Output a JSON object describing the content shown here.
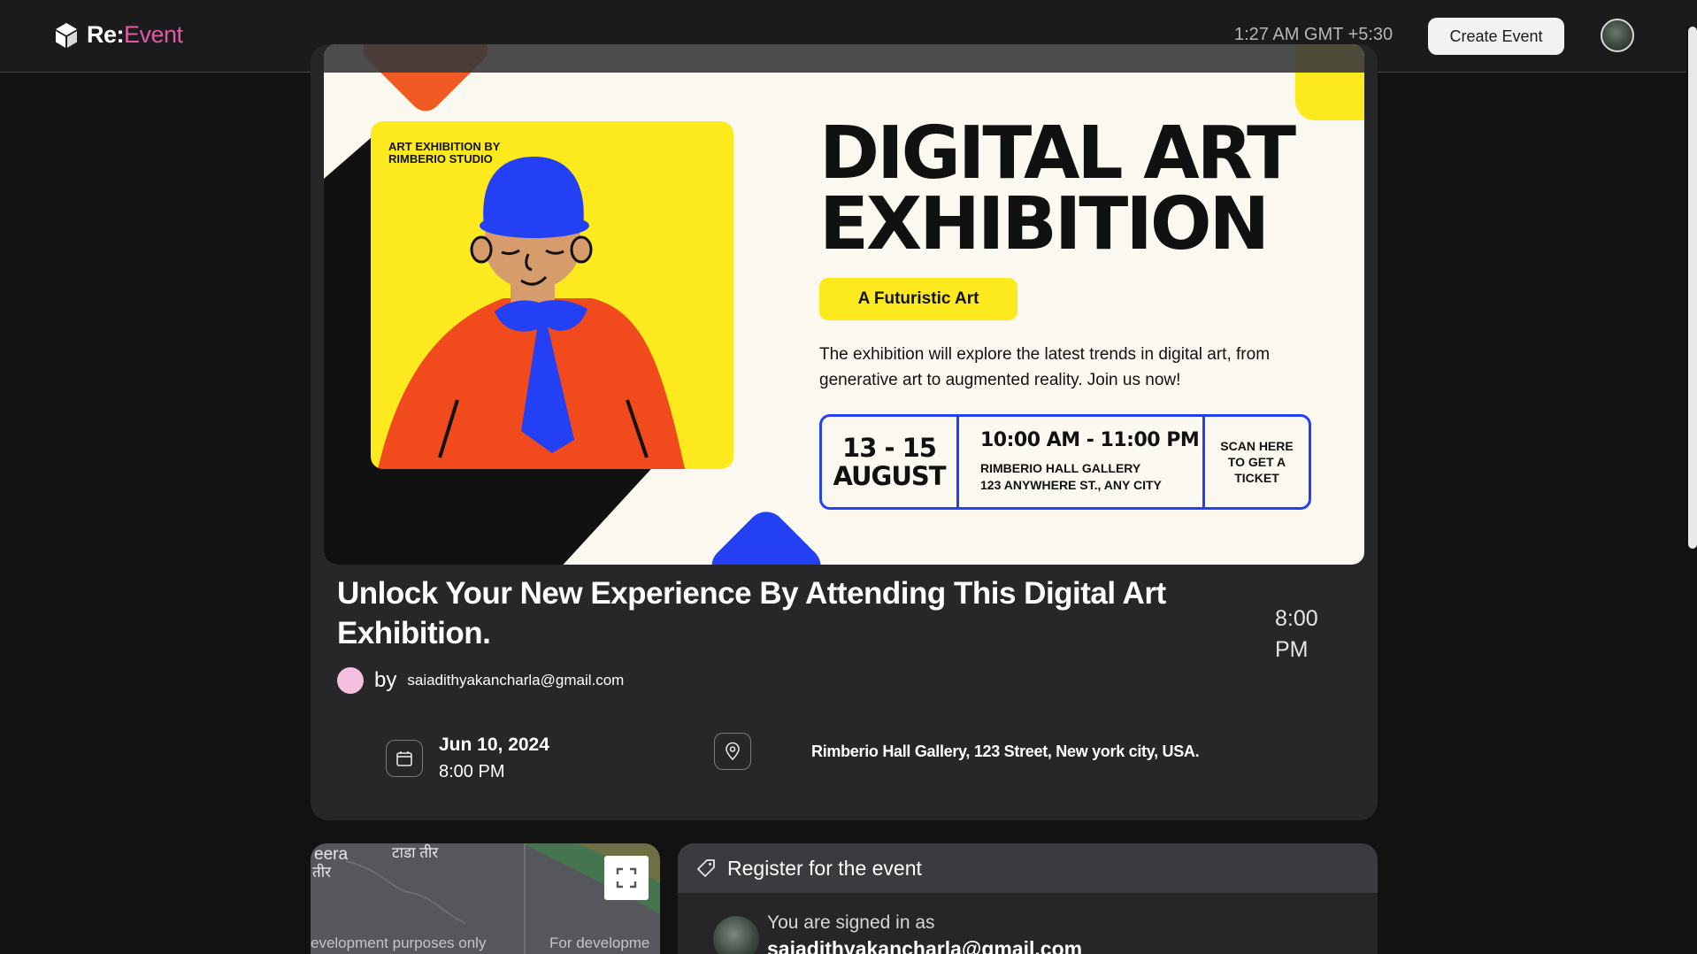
{
  "header": {
    "logo_prefix": "Re:",
    "logo_suffix": "Event",
    "clock": "1:27 AM GMT +5:30",
    "create_button": "Create Event"
  },
  "poster": {
    "studio_line1": "ART EXHIBITION BY",
    "studio_line2": "RIMBERIO STUDIO",
    "title_line1": "DIGITAL ART",
    "title_line2": "EXHIBITION",
    "tagline": "A Futuristic Art",
    "description": "The exhibition will explore the latest trends in digital art, from generative art to augmented reality. Join us now!",
    "date_line1": "13 - 15",
    "date_line2": "AUGUST",
    "time": "10:00 AM - 11:00 PM",
    "venue_line1": "RIMBERIO HALL GALLERY",
    "venue_line2": "123 ANYWHERE ST., ANY CITY",
    "scan": "SCAN HERE TO GET A TICKET"
  },
  "event": {
    "title": "Unlock Your New Experience By Attending This Digital Art Exhibition.",
    "time_right_1": "8:00",
    "time_right_2": "PM",
    "by_label": "by",
    "organizer_email": "saiadithyakancharla@gmail.com",
    "date": "Jun 10, 2024",
    "time": "8:00 PM",
    "location": "Rimberio Hall Gallery, 123 Street, New york city, USA."
  },
  "map": {
    "label_1": "eera",
    "label_2": "टाडा तीर",
    "label_3": "तीर",
    "dev_1": "evelopment purposes only",
    "dev_2": "For developme"
  },
  "register": {
    "title": "Register for the event",
    "signed_label": "You are signed in as",
    "signed_email": "saiadithyakancharla@gmail.com"
  },
  "colors": {
    "accent": "#e05aa3",
    "poster_yellow": "#fdea1e",
    "poster_blue": "#2340f5",
    "poster_orange": "#f15a22"
  }
}
